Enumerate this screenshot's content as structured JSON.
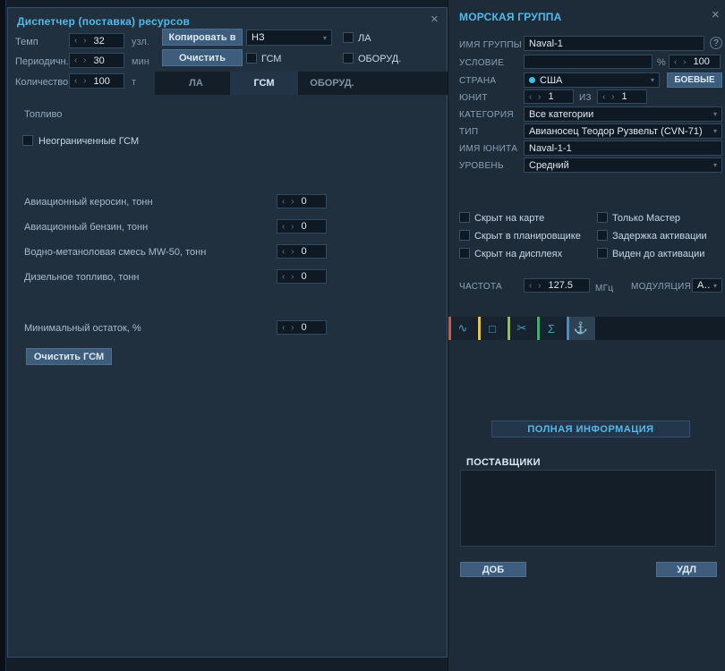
{
  "colors": {
    "accent": "#54b9e8",
    "button": "#3e5d7c"
  },
  "icons": {
    "close": "×",
    "stepper_arrows": "‹ ›",
    "chevron": "▾",
    "help": "?"
  },
  "left": {
    "title": "Диспетчер (поставка) ресурсов",
    "tempo": {
      "label": "Темп",
      "value": "32",
      "unit": "узл."
    },
    "period": {
      "label": "Периодичн.",
      "value": "30",
      "unit": "мин"
    },
    "amount": {
      "label": "Количество",
      "value": "100",
      "unit": "т"
    },
    "copy_to_button": "Копировать в",
    "copy_target": "НЗ",
    "clear_button": "Очистить",
    "copy_flags": [
      {
        "label": "ЛА"
      },
      {
        "label": "ГСМ"
      },
      {
        "label": "ОБОРУД."
      }
    ],
    "tabs": [
      {
        "label": "ЛА"
      },
      {
        "label": "ГСМ"
      },
      {
        "label": "ОБОРУД."
      }
    ],
    "active_tab": "ГСМ",
    "section": "Топливо",
    "unlimited": {
      "label": "Неограниченные ГСМ",
      "checked": false
    },
    "fuel_rows": [
      {
        "label": "Авиационный керосин, тонн",
        "value": "0"
      },
      {
        "label": "Авиационный бензин, тонн",
        "value": "0"
      },
      {
        "label": "Водно-метаноловая смесь MW-50, тонн",
        "value": "0"
      },
      {
        "label": "Дизельное топливо, тонн",
        "value": "0"
      }
    ],
    "min_remainder": {
      "label": "Минимальный остаток, %",
      "value": "0"
    },
    "clear_fuel_button": "Очистить ГСМ"
  },
  "right": {
    "title": "МОРСКАЯ ГРУППА",
    "group_name": {
      "label": "ИМЯ ГРУППЫ",
      "value": "Naval-1"
    },
    "condition": {
      "label": "УСЛОВИЕ",
      "value": "",
      "percent": "%",
      "amount": "100"
    },
    "country": {
      "label": "СТРАНА",
      "value": "США"
    },
    "combat_button": "БОЕВЫЕ",
    "unit": {
      "label": "ЮНИТ",
      "value": "1",
      "of_label": "ИЗ",
      "total": "1"
    },
    "category": {
      "label": "КАТЕГОРИЯ",
      "value": "Все категории"
    },
    "type": {
      "label": "ТИП",
      "value": "Авианосец Теодор Рузвельт (CVN-71)"
    },
    "unit_name": {
      "label": "ИМЯ ЮНИТА",
      "value": "Naval-1-1"
    },
    "level": {
      "label": "УРОВЕНЬ",
      "value": "Средний"
    },
    "flags": [
      {
        "label": "Скрыт на карте"
      },
      {
        "label": "Скрыт в планировщике"
      },
      {
        "label": "Скрыт на дисплеях"
      },
      {
        "label": "Только Мастер"
      },
      {
        "label": "Задержка активации"
      },
      {
        "label": "Виден до активации"
      }
    ],
    "frequency": {
      "label": "ЧАСТОТА",
      "value": "127.5",
      "unit": "МГц"
    },
    "modulation": {
      "label": "МОДУЛЯЦИЯ",
      "value": "AM"
    },
    "icon_tabs": [
      {
        "name": "route",
        "glyph": "∿",
        "color": "#e0514d"
      },
      {
        "name": "frame",
        "glyph": "□",
        "color": "#e3c44d"
      },
      {
        "name": "cut",
        "glyph": "✂",
        "color": "#8ec641"
      },
      {
        "name": "sum",
        "glyph": "Σ",
        "color": "#3fae6e"
      },
      {
        "name": "ship",
        "glyph": "⚓",
        "color": "#3f8fd4"
      }
    ],
    "full_info_button": "ПОЛНАЯ ИНФОРМАЦИЯ",
    "suppliers_label": "ПОСТАВЩИКИ",
    "add_button": "ДОБ",
    "del_button": "УДЛ"
  }
}
